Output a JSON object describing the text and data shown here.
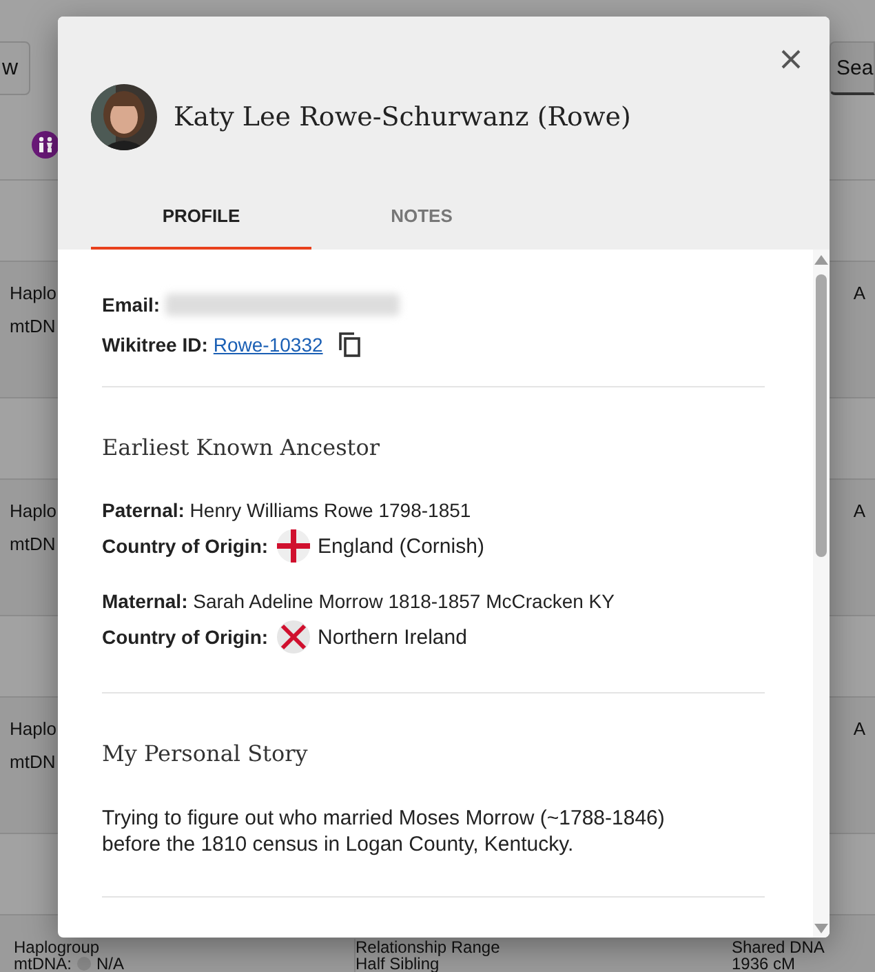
{
  "background": {
    "toolbar": {
      "left_button": "w",
      "right_button": "Sea"
    },
    "cards": [
      {
        "column_1": [
          "Haplo",
          "mtDN"
        ],
        "column_3": "A"
      },
      {
        "column_1": [
          "Haplo",
          "mtDN"
        ],
        "column_3": "A"
      },
      {
        "column_1": [
          "Haplo",
          "mtDN"
        ],
        "column_3": "A"
      }
    ],
    "bottom_card": [
      {
        "heading": "Haplogroup",
        "value": "mtDNA:",
        "value_2": "N/A"
      },
      {
        "heading": "Relationship Range",
        "value": "Half Sibling"
      },
      {
        "heading": "Shared DNA",
        "value": "1936 cM"
      }
    ]
  },
  "dialog": {
    "name": "Katy Lee Rowe-Schurwanz (Rowe)",
    "tabs": [
      {
        "label": "PROFILE",
        "selected": true
      },
      {
        "label": "NOTES",
        "selected": false
      }
    ],
    "email_label": "Email:",
    "wikitree_label": "Wikitree ID:",
    "wikitree_id": "Rowe-10332",
    "sections": [
      {
        "title": "Earliest Known Ancestor",
        "entries": [
          {
            "label": "Paternal:",
            "value": "Henry Williams Rowe 1798-1851",
            "origin_label": "Country of Origin:",
            "kind": "cross",
            "origin": "England (Cornish)"
          },
          {
            "label": "Maternal:",
            "value": "Sarah Adeline Morrow 1818-1857 McCracken KY",
            "origin_label": "Country of Origin:",
            "kind": "saltire",
            "origin": "Northern Ireland"
          }
        ]
      },
      {
        "title": "My Personal Story",
        "text": "Trying to figure out who married Moses Morrow (~1788-1846) before the 1810 census in Logan County, Kentucky."
      }
    ]
  }
}
